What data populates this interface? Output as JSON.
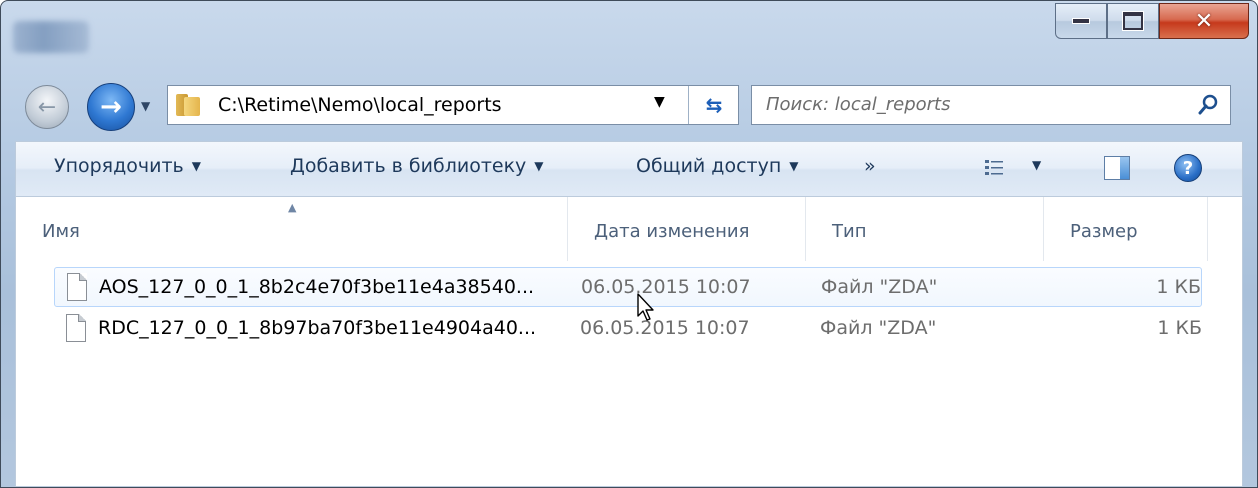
{
  "address": {
    "path": "C:\\Retime\\Nemo\\local_reports"
  },
  "search": {
    "placeholder": "Поиск: local_reports"
  },
  "toolbar": {
    "organize_label": "Упорядочить",
    "add_to_library_label": "Добавить в библиотеку",
    "share_label": "Общий доступ",
    "more_label": "»"
  },
  "columns": {
    "name": "Имя",
    "date": "Дата изменения",
    "type": "Тип",
    "size": "Размер"
  },
  "files": [
    {
      "name": "AOS_127_0_0_1_8b2c4e70f3be11e4a38540...",
      "date": "06.05.2015 10:07",
      "type": "Файл \"ZDA\"",
      "size": "1 КБ"
    },
    {
      "name": "RDC_127_0_0_1_8b97ba70f3be11e4904a40...",
      "date": "06.05.2015 10:07",
      "type": "Файл \"ZDA\"",
      "size": "1 КБ"
    }
  ],
  "icons": {
    "back": "back-arrow-icon",
    "forward": "forward-arrow-icon",
    "folder": "folder-icon",
    "refresh": "refresh-icon",
    "search": "search-icon",
    "views": "views-icon",
    "preview_pane": "preview-pane-icon",
    "help": "help-icon",
    "file": "file-icon"
  },
  "colors": {
    "accent": "#2f78d2",
    "close_button": "#c6391c",
    "hover_row_border": "#b8d6fb"
  }
}
